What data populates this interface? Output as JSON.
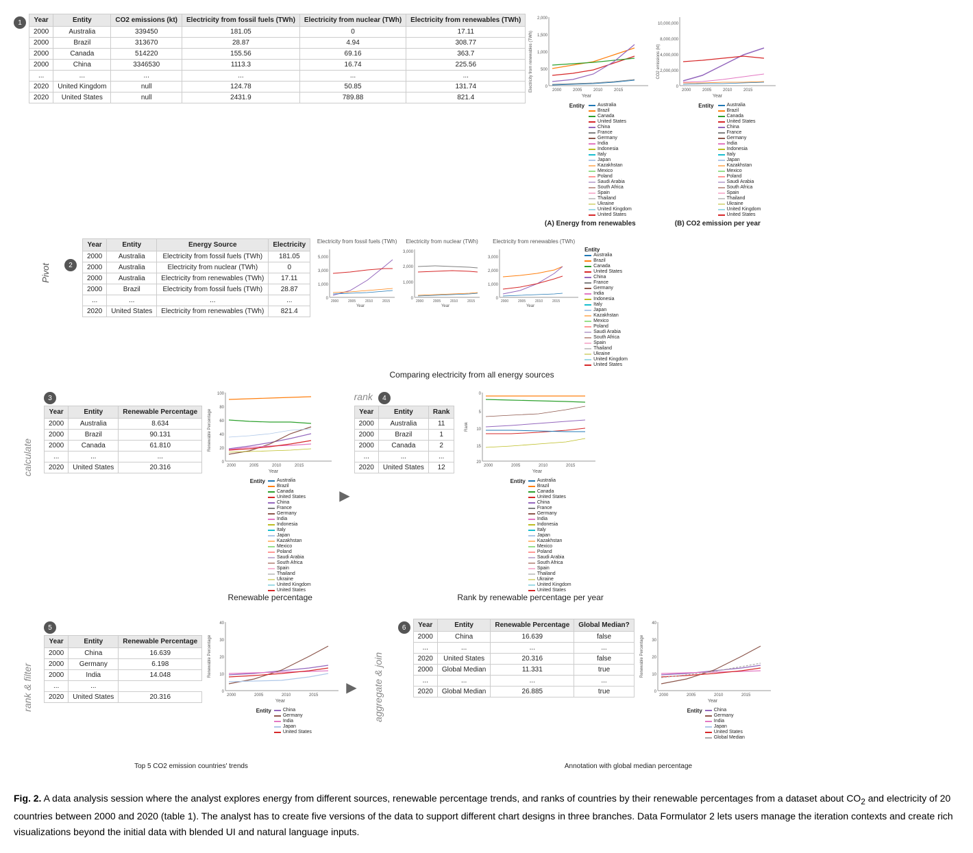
{
  "section1": {
    "num": "1",
    "table": {
      "headers": [
        "Year",
        "Entity",
        "CO2 emissions (kt)",
        "Electricity from fossil fuels (TWh)",
        "Electricity from nuclear (TWh)",
        "Electricity from renewables (TWh)"
      ],
      "rows": [
        [
          "2000",
          "Australia",
          "339450",
          "181.05",
          "0",
          "17.11"
        ],
        [
          "2000",
          "Brazil",
          "313670",
          "28.87",
          "4.94",
          "308.77"
        ],
        [
          "2000",
          "Canada",
          "514220",
          "155.56",
          "69.16",
          "363.7"
        ],
        [
          "2000",
          "China",
          "3346530",
          "1113.3",
          "16.74",
          "225.56"
        ],
        [
          "...",
          "...",
          "...",
          "...",
          "...",
          "..."
        ],
        [
          "2020",
          "United Kingdom",
          "null",
          "124.78",
          "50.85",
          "131.74"
        ],
        [
          "2020",
          "United States",
          "null",
          "2431.9",
          "789.88",
          "821.4"
        ]
      ]
    },
    "chartA": {
      "title": "(A) Energy from renewables",
      "xLabel": "Year",
      "yLabel": "Electricity from renewables (TWh)"
    },
    "chartB": {
      "title": "(B) CO2 emission per year",
      "xLabel": "Year",
      "yLabel": "CO2 emissions (kt)"
    }
  },
  "section2": {
    "num": "2",
    "label": "Pivot",
    "table": {
      "headers": [
        "Year",
        "Entity",
        "Energy Source",
        "Electricity"
      ],
      "rows": [
        [
          "2000",
          "Australia",
          "Electricity from fossil fuels (TWh)",
          "181.05"
        ],
        [
          "2000",
          "Australia",
          "Electricity from nuclear (TWh)",
          "0"
        ],
        [
          "2000",
          "Australia",
          "Electricity from renewables (TWh)",
          "17.11"
        ],
        [
          "2000",
          "Brazil",
          "Electricity from fossil fuels (TWh)",
          "28.87"
        ],
        [
          "...",
          "...",
          "...",
          "..."
        ],
        [
          "2020",
          "United States",
          "Electricity from renewables (TWh)",
          "821.4"
        ]
      ]
    },
    "chartTitle": "Comparing electricity from all energy sources"
  },
  "section3": {
    "num": "3",
    "table": {
      "headers": [
        "Year",
        "Entity",
        "Renewable Percentage"
      ],
      "rows": [
        [
          "2000",
          "Australia",
          "8.634"
        ],
        [
          "2000",
          "Brazil",
          "90.131"
        ],
        [
          "2000",
          "Canada",
          "61.810"
        ],
        [
          "...",
          "...",
          "..."
        ],
        [
          "2020",
          "United States",
          "20.316"
        ]
      ]
    },
    "chartTitle": "Renewable percentage"
  },
  "section4": {
    "num": "4",
    "label": "rank",
    "table": {
      "headers": [
        "Year",
        "Entity",
        "Rank"
      ],
      "rows": [
        [
          "2000",
          "Australia",
          "11"
        ],
        [
          "2000",
          "Brazil",
          "1"
        ],
        [
          "2000",
          "Canada",
          "2"
        ],
        [
          "...",
          "...",
          "..."
        ],
        [
          "2020",
          "United States",
          "12"
        ]
      ]
    },
    "chartTitle": "Rank by renewable percentage per year"
  },
  "section5": {
    "num": "5",
    "table": {
      "headers": [
        "Year",
        "Entity",
        "Renewable Percentage"
      ],
      "rows": [
        [
          "2000",
          "China",
          "16.639"
        ],
        [
          "2000",
          "Germany",
          "6.198"
        ],
        [
          "2000",
          "India",
          "14.048"
        ],
        [
          "...",
          "..."
        ],
        [
          "2020",
          "United States",
          "20.316"
        ]
      ]
    },
    "captionLeft": "Top 5 CO2 emission countries' trends"
  },
  "section6": {
    "num": "6",
    "label": "aggregate & join",
    "table": {
      "headers": [
        "Year",
        "Entity",
        "Renewable Percentage",
        "Global Median?"
      ],
      "rows": [
        [
          "2000",
          "China",
          "16.639",
          "false"
        ],
        [
          "...",
          "...",
          "...",
          "..."
        ],
        [
          "2020",
          "United States",
          "20.316",
          "false"
        ],
        [
          "2000",
          "Global Median",
          "11.331",
          "true"
        ],
        [
          "...",
          "...",
          "...",
          "..."
        ],
        [
          "2020",
          "Global Median",
          "26.885",
          "true"
        ]
      ]
    },
    "captionRight": "Annotation with global median percentage"
  },
  "figCaption": {
    "label": "Fig. 2.",
    "text": " A data analysis session where the analyst explores energy from different sources, renewable percentage trends, and ranks of countries by their renewable percentages from a dataset about CO",
    "sub": "2",
    "text2": " and electricity of 20 countries between 2000 and 2020 (table 1). The analyst has to create five versions of the data to support different chart designs in three branches. Data Formulator 2 lets users manage the iteration contexts and create rich visualizations beyond the initial data with blended UI and natural language inputs."
  },
  "legends": {
    "main": [
      "Australia",
      "Brazil",
      "Canada",
      "United States",
      "China",
      "France",
      "Germany",
      "India",
      "Indonesia",
      "Italy",
      "Japan",
      "Kazakhstan",
      "Mexico",
      "Poland",
      "Saudi Arabia",
      "South Africa",
      "Spain",
      "Thailand",
      "Ukraine",
      "United Kingdom",
      "United States"
    ],
    "filtered": [
      "China",
      "Germany",
      "India",
      "Japan",
      "United States"
    ],
    "colors": {
      "Australia": "#1f77b4",
      "Brazil": "#ff7f0e",
      "Canada": "#2ca02c",
      "United States": "#d62728",
      "China": "#9467bd",
      "Germany": "#8c564b",
      "India": "#e377c2",
      "France": "#7f7f7f",
      "Indonesia": "#bcbd22",
      "Italy": "#17becf",
      "Japan": "#aec7e8",
      "Kazakhstan": "#ffbb78",
      "Mexico": "#98df8a",
      "Poland": "#ff9896",
      "Saudi Arabia": "#c5b0d5",
      "South Africa": "#c49c94",
      "Spain": "#f7b6d2",
      "Thailand": "#c7c7c7",
      "Ukraine": "#dbdb8d",
      "United Kingdom": "#9edae5",
      "Global Median": "#aaa"
    }
  }
}
